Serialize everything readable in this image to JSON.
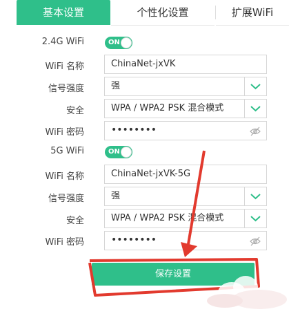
{
  "tabs": [
    {
      "label": "基本设置",
      "active": true
    },
    {
      "label": "个性化设置",
      "active": false
    },
    {
      "label": "扩展WiFi",
      "active": false
    }
  ],
  "band24": {
    "label": "2.4G WiFi",
    "toggle": "ON",
    "name_label": "WiFi 名称",
    "name_value": "ChinaNet-jxVK",
    "signal_label": "信号强度",
    "signal_value": "强",
    "security_label": "安全",
    "security_value": "WPA / WPA2 PSK 混合模式",
    "password_label": "WiFi 密码",
    "password_mask": "••••••••"
  },
  "band5": {
    "label": "5G WiFi",
    "toggle": "ON",
    "name_label": "WiFi 名称",
    "name_value": "ChinaNet-jxVK-5G",
    "signal_label": "信号强度",
    "signal_value": "强",
    "security_label": "安全",
    "security_value": "WPA / WPA2 PSK 混合模式",
    "password_label": "WiFi 密码",
    "password_mask": "••••••••"
  },
  "save_label": "保存设置",
  "colors": {
    "accent": "#2fbf8a",
    "annotation": "#e23a2e"
  }
}
